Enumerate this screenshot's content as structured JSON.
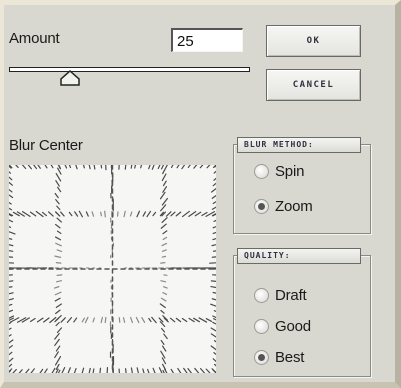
{
  "amount": {
    "label": "Amount",
    "value": "25",
    "slider_level_percent": 25
  },
  "buttons": {
    "ok_label": "OK",
    "cancel_label": "CANCEL"
  },
  "blur_center": {
    "label": "Blur Center"
  },
  "blur_method": {
    "title": "BLUR METHOD:",
    "options": [
      {
        "label": "Spin",
        "selected": false
      },
      {
        "label": "Zoom",
        "selected": true
      }
    ]
  },
  "quality": {
    "title": "QUALITY:",
    "options": [
      {
        "label": "Draft",
        "selected": false
      },
      {
        "label": "Good",
        "selected": false
      },
      {
        "label": "Best",
        "selected": true
      }
    ]
  },
  "colors": {
    "background": "#d8d8d0",
    "preview": "#f6f6f4",
    "text": "#1a1a1a"
  }
}
